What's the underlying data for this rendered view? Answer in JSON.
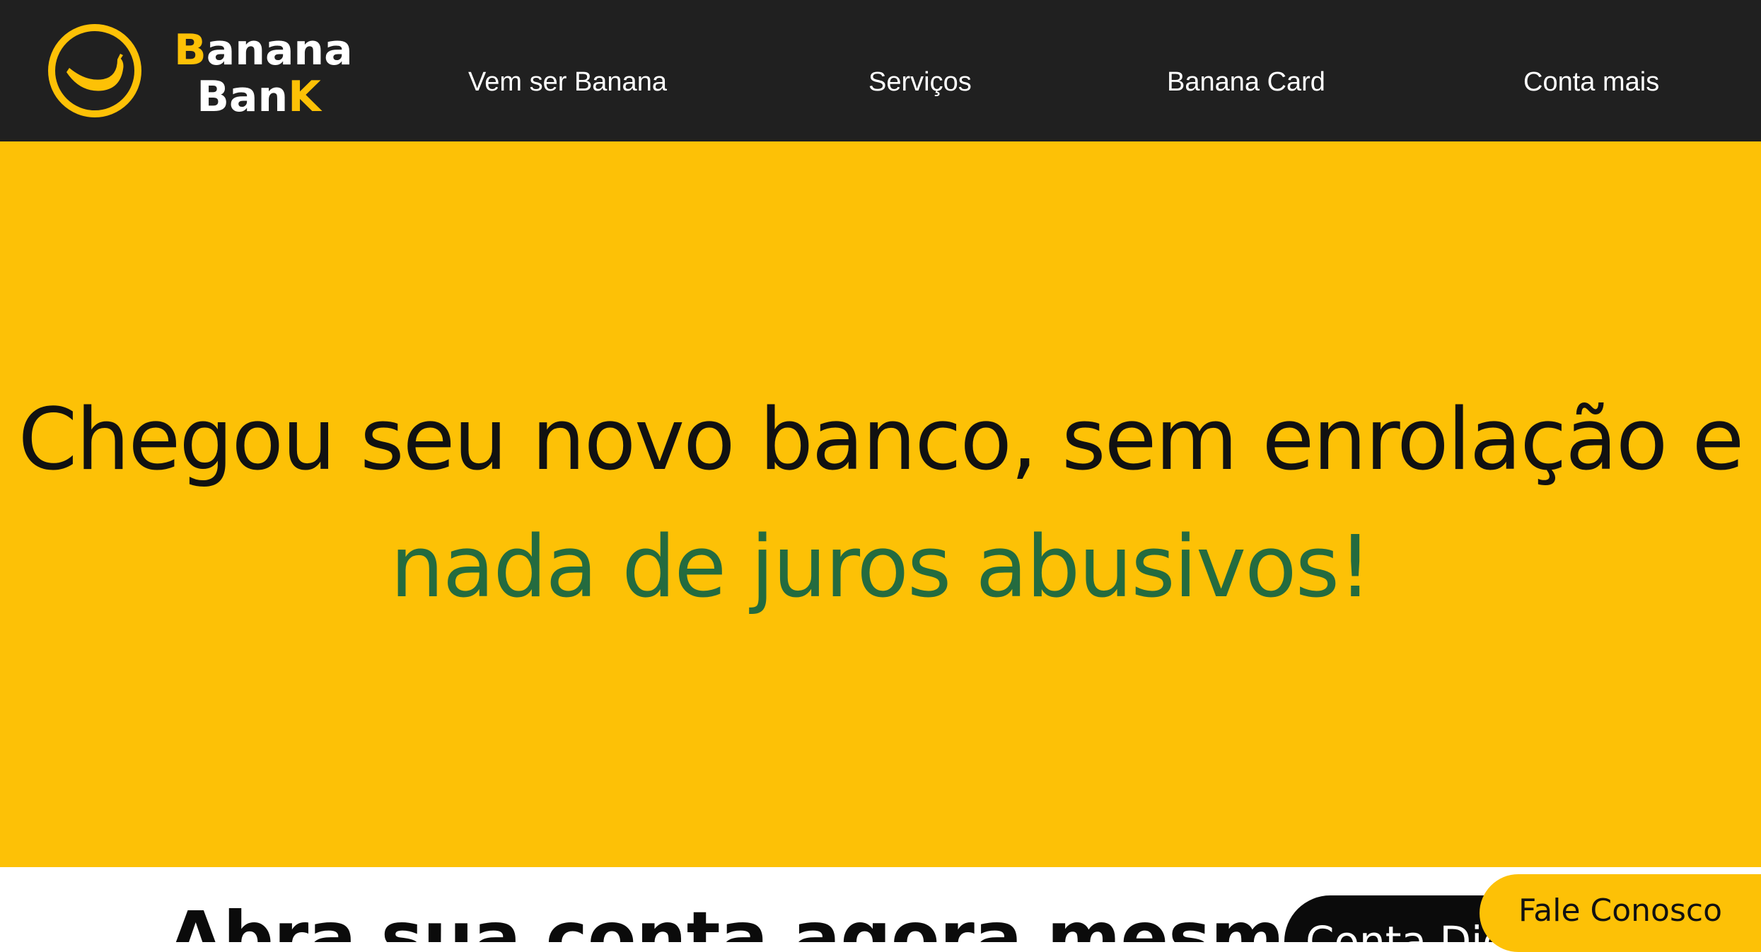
{
  "colors": {
    "header_bg": "#202020",
    "brand_accent": "#fdc106",
    "hero_bg": "#fdc106",
    "hero_text": "#111111",
    "hero_highlight": "#246b3f"
  },
  "header": {
    "logo_icon": "banana-smile-logo-icon",
    "brand": {
      "line1_first": "B",
      "line1_rest": "anana",
      "line2_first": "Ban",
      "line2_last": "K"
    },
    "nav": [
      {
        "label": "Vem ser Banana"
      },
      {
        "label": "Serviços"
      },
      {
        "label": "Banana Card"
      },
      {
        "label": "Conta mais"
      }
    ]
  },
  "hero": {
    "line1": "Chegou seu novo banco, sem enrolação e",
    "line2": "nada de juros abusivos!"
  },
  "cta": {
    "heading": "Abra sua conta agora mesmo!",
    "button_label": "Conta Digital"
  },
  "contact": {
    "label": "Fale Conosco"
  }
}
